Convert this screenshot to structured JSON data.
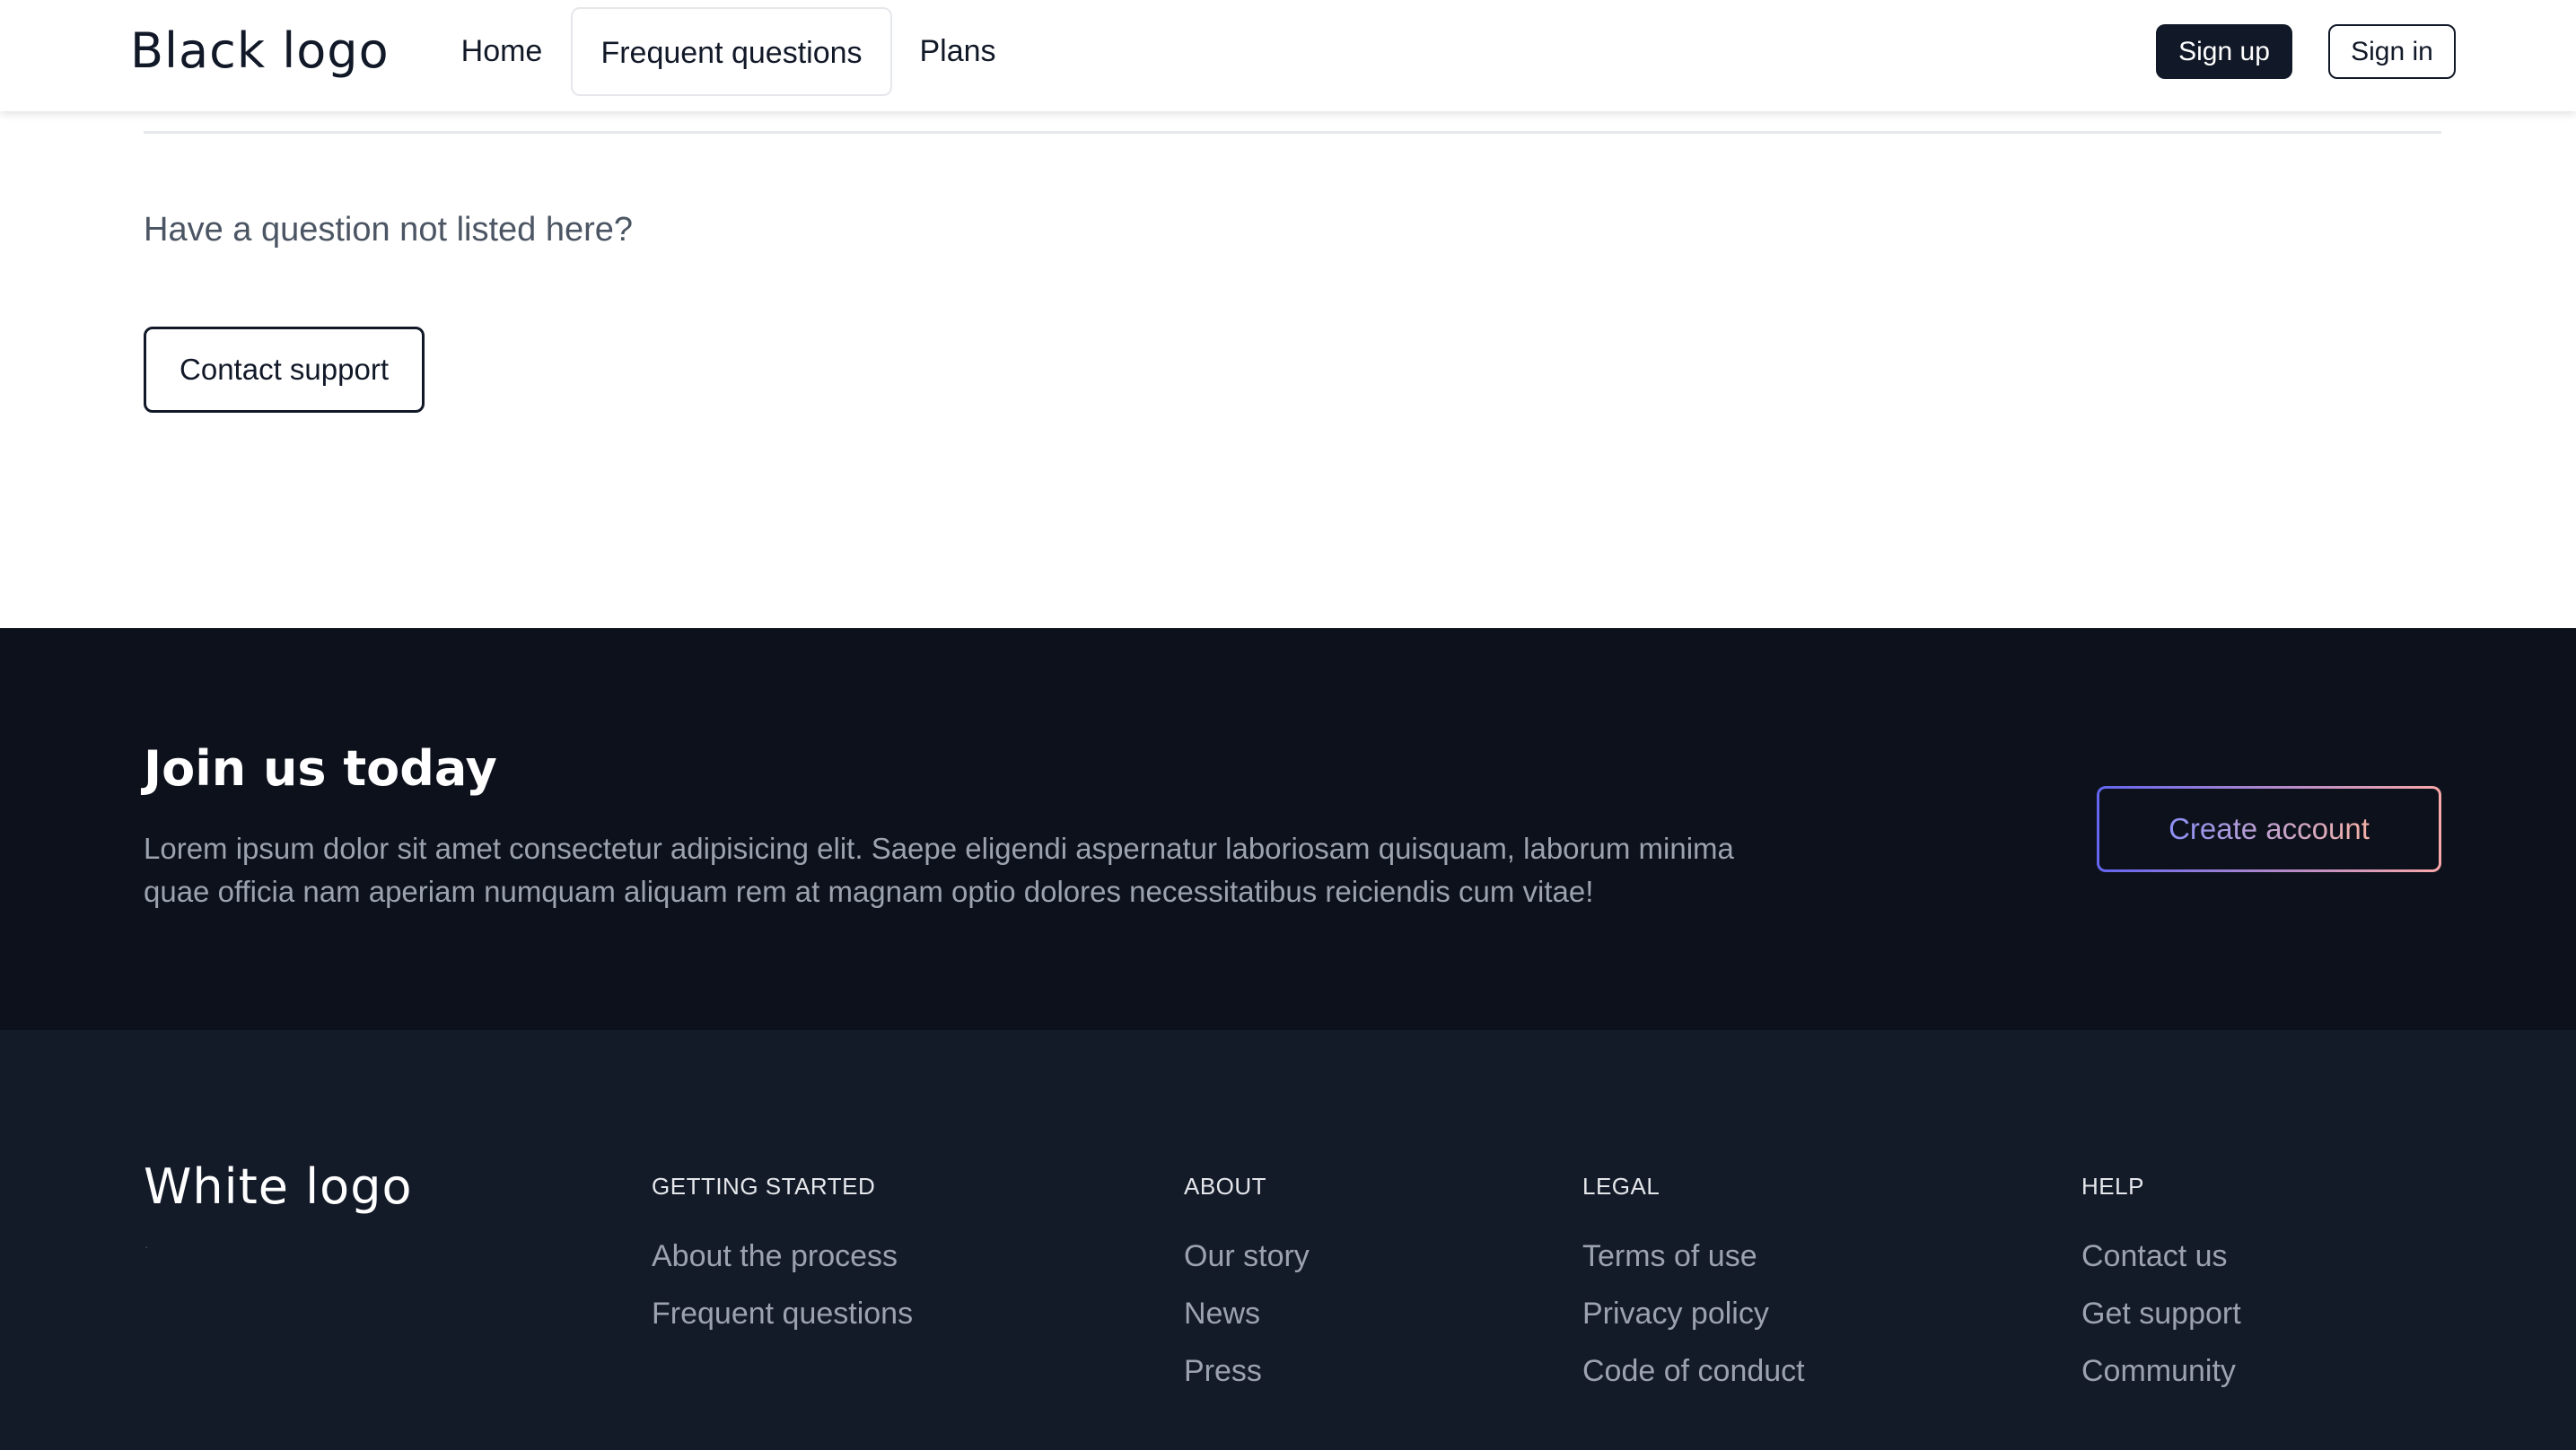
{
  "header": {
    "logo": "Black logo",
    "nav": [
      {
        "label": "Home"
      },
      {
        "label": "Frequent questions",
        "active": true
      },
      {
        "label": "Plans"
      }
    ],
    "signup_label": "Sign up",
    "signin_label": "Sign in"
  },
  "faq": {
    "question_text": "Have a question not listed here?",
    "contact_label": "Contact support"
  },
  "cta": {
    "title": "Join us today",
    "body": "Lorem ipsum dolor sit amet consectetur adipisicing elit. Saepe eligendi aspernatur laboriosam quisquam, laborum minima quae officia nam aperiam numquam aliquam rem at magnam optio dolores necessitatibus reiciendis cum vitae!",
    "button_label": "Create account"
  },
  "footer": {
    "logo": "White logo",
    "columns": [
      {
        "heading": "GETTING STARTED",
        "links": [
          "About the process",
          "Frequent questions"
        ]
      },
      {
        "heading": "ABOUT",
        "links": [
          "Our story",
          "News",
          "Press"
        ]
      },
      {
        "heading": "LEGAL",
        "links": [
          "Terms of use",
          "Privacy policy",
          "Code of conduct"
        ]
      },
      {
        "heading": "HELP",
        "links": [
          "Contact us",
          "Get support",
          "Community"
        ]
      }
    ]
  },
  "colors": {
    "primary_dark": "#111827",
    "cta_background": "#0c111c",
    "footer_background": "#131a28",
    "muted_text": "#9ca3af",
    "gradient_start": "#6366f1",
    "gradient_end": "#f9a8a8"
  }
}
